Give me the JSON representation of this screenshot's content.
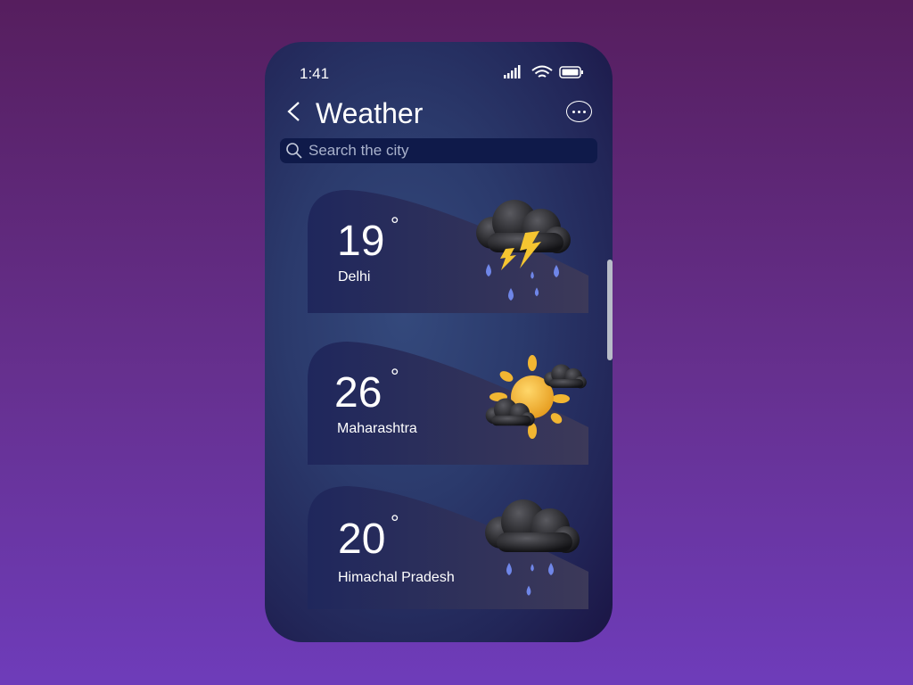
{
  "status": {
    "time": "1:41",
    "icons": [
      "signal-icon",
      "wifi-icon",
      "battery-icon"
    ]
  },
  "header": {
    "title": "Weather",
    "back_icon": "chevron-left-icon",
    "more_icon": "ellipsis-circle-icon"
  },
  "search": {
    "placeholder": "Search the city"
  },
  "cards": [
    {
      "temp": "19",
      "degree": "°",
      "city": "Delhi",
      "icon": "thunderstorm-rain-icon"
    },
    {
      "temp": "26",
      "degree": "°",
      "city": "Maharashtra",
      "icon": "sun-clouds-icon"
    },
    {
      "temp": "20",
      "degree": "°",
      "city": "Himachal Pradesh",
      "icon": "rain-cloud-icon"
    }
  ],
  "colors": {
    "accent": "#f5b933",
    "drop": "#6f86e8",
    "cloud": "#1d1d22"
  }
}
